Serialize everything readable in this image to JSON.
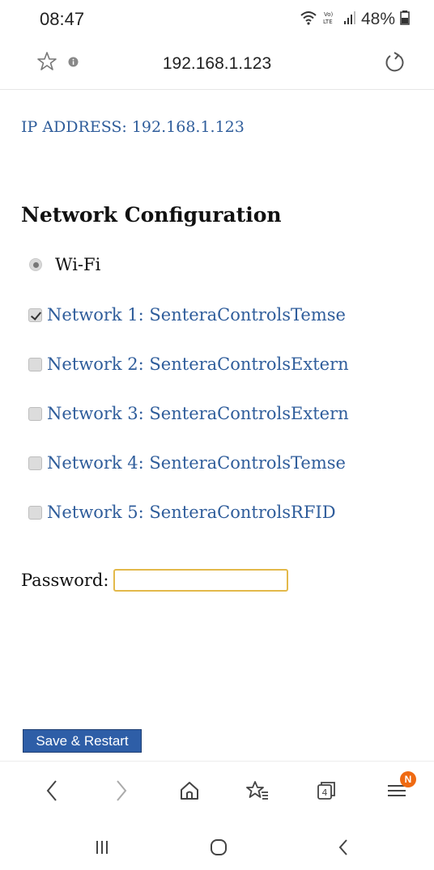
{
  "status_bar": {
    "time": "08:47",
    "battery": "48%",
    "icons": [
      "wifi-icon",
      "volte-lte-icon",
      "signal-icon",
      "battery-icon"
    ]
  },
  "url_bar": {
    "url": "192.168.1.123",
    "icons": [
      "star-icon",
      "info-icon",
      "reload-icon"
    ]
  },
  "page": {
    "ip_line": "IP ADDRESS: 192.168.1.123",
    "title": "Network Configuration",
    "mode": {
      "label": "Wi-Fi",
      "selected": true
    },
    "networks": [
      {
        "label": "Network 1: SenteraControlsTemse",
        "checked": true
      },
      {
        "label": "Network 2: SenteraControlsExtern",
        "checked": false
      },
      {
        "label": "Network 3: SenteraControlsExtern",
        "checked": false
      },
      {
        "label": "Network 4: SenteraControlsTemse",
        "checked": false
      },
      {
        "label": "Network 5: SenteraControlsRFID",
        "checked": false
      }
    ],
    "password_label": "Password:",
    "password_value": "",
    "save_button": "Save & Restart"
  },
  "browser_toolbar": {
    "items": [
      "back-icon",
      "forward-icon",
      "home-icon",
      "bookmarks-icon",
      "tabs-icon",
      "menu-icon"
    ],
    "tabs_count": "4",
    "menu_badge": "N"
  },
  "nav_bar": {
    "items": [
      "recents-icon",
      "home-circle-icon",
      "back-chevron-icon"
    ]
  },
  "colors": {
    "link_blue": "#2f5d9b",
    "button_blue": "#2e5ea7",
    "input_border": "#e3b94a",
    "badge_orange": "#ef6a12"
  }
}
